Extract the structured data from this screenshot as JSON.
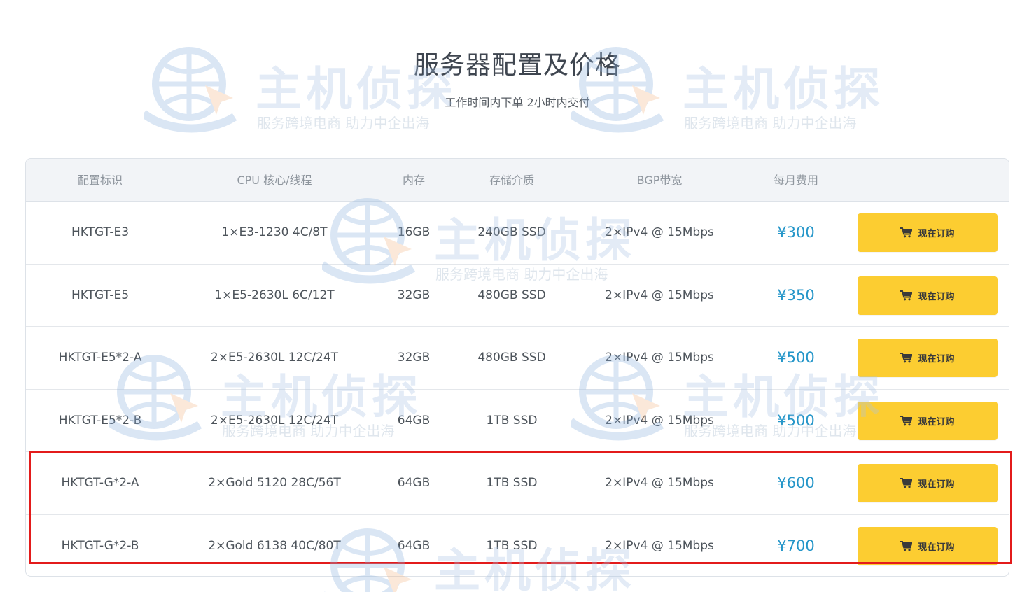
{
  "header": {
    "title": "服务器配置及价格",
    "subtitle": "工作时间内下单 2小时内交付"
  },
  "table": {
    "columns": [
      "配置标识",
      "CPU 核心/线程",
      "内存",
      "存储介质",
      "BGP带宽",
      "每月费用"
    ],
    "rows": [
      {
        "id": "HKTGT-E3",
        "cpu": "1×E3-1230 4C/8T",
        "memory": "16GB",
        "storage": "240GB SSD",
        "bandwidth": "2×IPv4 @ 15Mbps",
        "price": "¥300"
      },
      {
        "id": "HKTGT-E5",
        "cpu": "1×E5-2630L 6C/12T",
        "memory": "32GB",
        "storage": "480GB SSD",
        "bandwidth": "2×IPv4 @ 15Mbps",
        "price": "¥350"
      },
      {
        "id": "HKTGT-E5*2-A",
        "cpu": "2×E5-2630L 12C/24T",
        "memory": "32GB",
        "storage": "480GB SSD",
        "bandwidth": "2×IPv4 @ 15Mbps",
        "price": "¥500"
      },
      {
        "id": "HKTGT-E5*2-B",
        "cpu": "2×E5-2630L 12C/24T",
        "memory": "64GB",
        "storage": "1TB SSD",
        "bandwidth": "2×IPv4 @ 15Mbps",
        "price": "¥500"
      },
      {
        "id": "HKTGT-G*2-A",
        "cpu": "2×Gold 5120 28C/56T",
        "memory": "64GB",
        "storage": "1TB SSD",
        "bandwidth": "2×IPv4 @ 15Mbps",
        "price": "¥600"
      },
      {
        "id": "HKTGT-G*2-B",
        "cpu": "2×Gold 6138 40C/80T",
        "memory": "64GB",
        "storage": "1TB SSD",
        "bandwidth": "2×IPv4 @ 15Mbps",
        "price": "¥700"
      }
    ],
    "order_button_label": "现在订购",
    "order_icon": "cart-icon"
  },
  "watermark": {
    "brand": "主机侦探",
    "slogan": "服务跨境电商  助力中企出海"
  },
  "colors": {
    "button": "#fccd31",
    "price": "#2596c9",
    "highlight": "#e31b1b",
    "header_bg": "#f2f4f7"
  }
}
